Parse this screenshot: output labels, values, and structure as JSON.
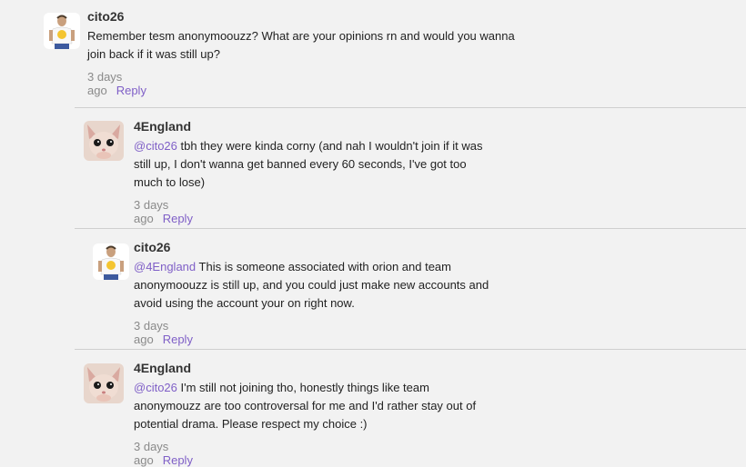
{
  "comments": [
    {
      "username": "cito26",
      "avatar": "cito-avatar",
      "mention": "",
      "text": "Remember tesm anonymoouzz? What are your opinions rn and would you wanna join back if it was still up?",
      "time": "3 days ago",
      "reply_label": "Reply"
    },
    {
      "username": "4England",
      "avatar": "cat-avatar",
      "mention": "@cito26",
      "text": " tbh they were kinda corny (and nah I wouldn't join if it was still up, I don't wanna get banned every 60 seconds, I've got too much to lose)",
      "time": "3 days ago",
      "reply_label": "Reply"
    },
    {
      "username": "cito26",
      "avatar": "cito-avatar",
      "mention": "@4England",
      "text": " This is someone associated with orion and team anonymoouzz is still up, and you could just make new accounts and avoid using the account your on right now.",
      "time": "3 days ago",
      "reply_label": "Reply"
    },
    {
      "username": "4England",
      "avatar": "cat-avatar",
      "mention": "@cito26",
      "text": " I'm still not joining tho, honestly things like team anonymouzz are too controversal for me and I'd rather stay out of potential drama. Please respect my choice :)",
      "time": "3 days ago",
      "reply_label": "Reply"
    }
  ]
}
